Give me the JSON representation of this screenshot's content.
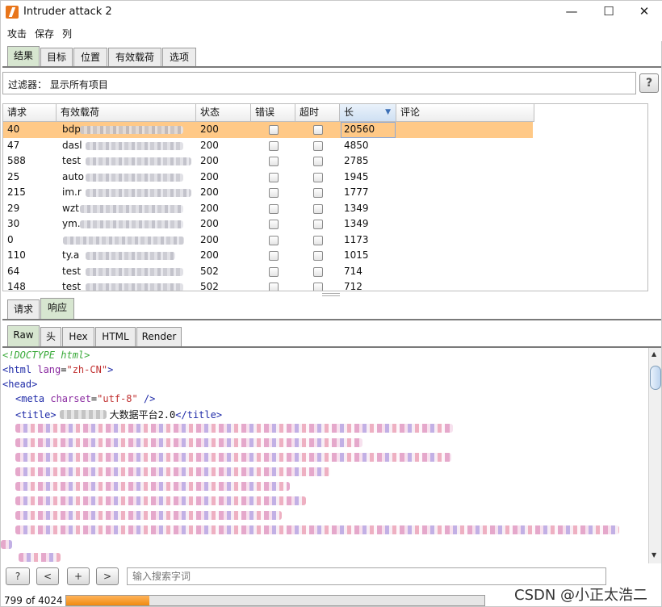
{
  "window": {
    "title": "Intruder attack 2",
    "minimize": "—",
    "maximize": "☐",
    "close": "✕"
  },
  "menu": [
    "攻击",
    "保存",
    "列"
  ],
  "main_tabs": [
    "结果",
    "目标",
    "位置",
    "有效载荷",
    "选项"
  ],
  "filter": {
    "text": "过滤器： 显示所有项目",
    "help_label": "?"
  },
  "table": {
    "columns": [
      "请求",
      "有效载荷",
      "状态",
      "错误",
      "超时",
      "长",
      "评论"
    ],
    "sort_indicator": "▼",
    "rows": [
      {
        "request": "40",
        "payload": "bdp",
        "status": "200",
        "length": "20560",
        "selected": true
      },
      {
        "request": "47",
        "payload": "dasl",
        "status": "200",
        "length": "4850"
      },
      {
        "request": "588",
        "payload": "test",
        "status": "200",
        "length": "2785"
      },
      {
        "request": "25",
        "payload": "auto",
        "status": "200",
        "length": "1945"
      },
      {
        "request": "215",
        "payload": "im.r",
        "status": "200",
        "length": "1777"
      },
      {
        "request": "29",
        "payload": "wzt",
        "status": "200",
        "length": "1349"
      },
      {
        "request": "30",
        "payload": "ym.",
        "status": "200",
        "length": "1349"
      },
      {
        "request": "0",
        "payload": "",
        "status": "200",
        "length": "1173"
      },
      {
        "request": "110",
        "payload": "ty.a",
        "status": "200",
        "length": "1015"
      },
      {
        "request": "64",
        "payload": "test",
        "status": "502",
        "length": "714"
      },
      {
        "request": "148",
        "payload": "test",
        "status": "502",
        "length": "712"
      }
    ]
  },
  "detail_tabs": [
    "请求",
    "响应"
  ],
  "view_tabs": [
    "Raw",
    "头",
    "Hex",
    "HTML",
    "Render"
  ],
  "code": {
    "doctype": "<!DOCTYPE html>",
    "html_open": "<html",
    "html_attr": " lang",
    "html_val": "\"zh-CN\"",
    "html_close": ">",
    "head": "<head>",
    "meta_open": "<meta",
    "meta_attr": " charset",
    "meta_val": "\"utf-8\"",
    "meta_close": " />",
    "title_open": "<title>",
    "title_text": "大数据平台2.0",
    "title_close": "</title>"
  },
  "bottom_bar": {
    "help": "?",
    "prev": "<",
    "add": "+",
    "next": ">",
    "search_placeholder": "输入搜索字词"
  },
  "status": {
    "count_text": "799 of 4024",
    "progress_fraction": 0.199
  },
  "watermark": "CSDN @小正太浩二",
  "colors": {
    "selected_row": "#ffc987",
    "progress": "#f08a10",
    "app_icon": "#e8751a"
  }
}
